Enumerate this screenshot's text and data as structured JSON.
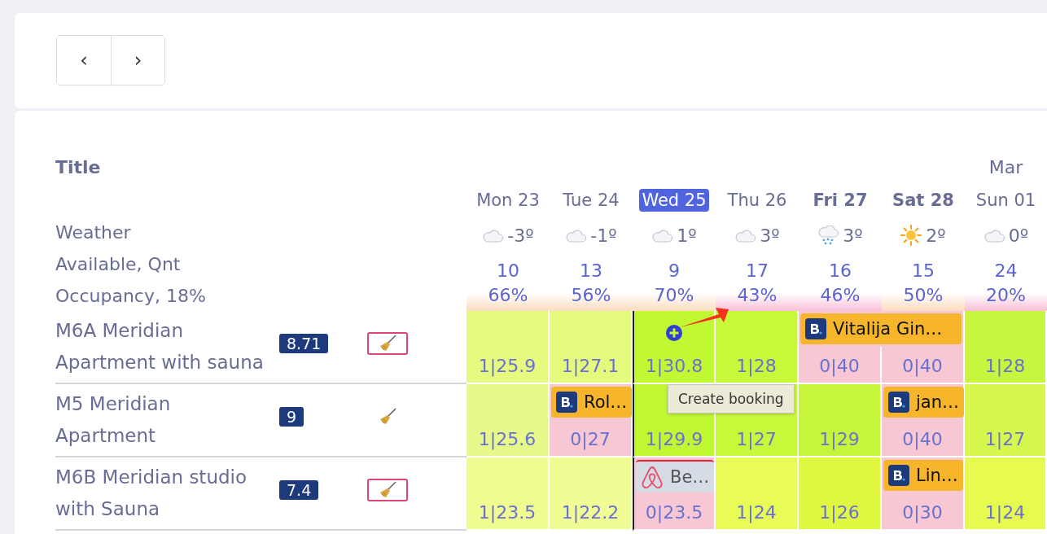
{
  "nav": {
    "prev": "‹",
    "next": "›"
  },
  "header": {
    "title": "Title",
    "month": "Mar",
    "labels": [
      "Weather",
      "Available, Qnt",
      "Occupancy, 18%"
    ]
  },
  "days": [
    {
      "label": "Mon 23",
      "selected": false,
      "weekend": false,
      "weather": {
        "kind": "cloud",
        "temp": "-3º"
      },
      "available": "10",
      "occupancy": "66%",
      "color": "#fbdcbf"
    },
    {
      "label": "Tue 24",
      "selected": false,
      "weekend": false,
      "weather": {
        "kind": "cloud",
        "temp": "-1º"
      },
      "available": "13",
      "occupancy": "56%",
      "color": "#fbdcbf"
    },
    {
      "label": "Wed 25",
      "selected": true,
      "weekend": false,
      "weather": {
        "kind": "cloud",
        "temp": "1º"
      },
      "available": "9",
      "occupancy": "70%",
      "color": "#fbdcbf"
    },
    {
      "label": "Thu 26",
      "selected": false,
      "weekend": false,
      "weather": {
        "kind": "cloud",
        "temp": "3º"
      },
      "available": "17",
      "occupancy": "43%",
      "color": "#f9bfd8"
    },
    {
      "label": "Fri 27",
      "selected": false,
      "weekend": true,
      "weather": {
        "kind": "snow",
        "temp": "3º"
      },
      "available": "16",
      "occupancy": "46%",
      "color": "#f9bfd8"
    },
    {
      "label": "Sat 28",
      "selected": false,
      "weekend": true,
      "weather": {
        "kind": "sun",
        "temp": "2º"
      },
      "available": "15",
      "occupancy": "50%",
      "color": "#fbdcbf"
    },
    {
      "label": "Sun 01",
      "selected": false,
      "weekend": false,
      "weather": {
        "kind": "cloud",
        "temp": "0º"
      },
      "available": "24",
      "occupancy": "20%",
      "color": "#f9bfd8"
    }
  ],
  "rows": [
    {
      "name": "M6A Meridian Apartment with sauna",
      "score": "8.71",
      "cleaning_flagged": true,
      "cells": [
        {
          "value": "1|25.9",
          "color": "#e6fa80"
        },
        {
          "value": "1|27.1",
          "color": "#e3fa7c"
        },
        {
          "value": "1|30.8",
          "color": "#c0f834",
          "hover": true
        },
        {
          "value": "1|28",
          "color": "#c8f83a"
        },
        {
          "value": "0|40",
          "color": "#f7c8d3",
          "booking": {
            "guest": "Vitalija Gin…",
            "kind": "booking"
          }
        },
        {
          "value": "0|40",
          "color": "#f7c8d3",
          "booking_continues": true
        },
        {
          "value": "1|28",
          "color": "#c8f53e"
        }
      ]
    },
    {
      "name": "M5 Meridian Apartment",
      "score": "9",
      "cleaning_flagged": false,
      "cells": [
        {
          "value": "1|25.6",
          "color": "#e7f98a"
        },
        {
          "value": "0|27",
          "color": "#f7c8d3",
          "booking": {
            "guest": "Rol…",
            "kind": "booking"
          }
        },
        {
          "value": "1|29.9",
          "color": "#bff733"
        },
        {
          "value": "1|27",
          "color": "#c8f83a"
        },
        {
          "value": "1|29",
          "color": "#c6f63a"
        },
        {
          "value": "0|40",
          "color": "#f7c8d3",
          "booking": {
            "guest": "jan…",
            "kind": "booking"
          }
        },
        {
          "value": "1|27",
          "color": "#d6f84e"
        }
      ]
    },
    {
      "name": "M6B Meridian studio with Sauna",
      "score": "7.4",
      "cleaning_flagged": true,
      "cells": [
        {
          "value": "1|23.5",
          "color": "#f0fb90"
        },
        {
          "value": "1|22.2",
          "color": "#f2fc95"
        },
        {
          "value": "0|23.5",
          "color": "#f7c8d3",
          "booking": {
            "guest": "Be…",
            "kind": "airbnb"
          }
        },
        {
          "value": "1|24",
          "color": "#e9fb56"
        },
        {
          "value": "1|26",
          "color": "#e0f840"
        },
        {
          "value": "0|30",
          "color": "#f7c8d3",
          "booking": {
            "guest": "Lin…",
            "kind": "booking"
          }
        },
        {
          "value": "1|24",
          "color": "#e6fa50"
        }
      ]
    }
  ],
  "tooltip": {
    "text": "Create booking"
  }
}
